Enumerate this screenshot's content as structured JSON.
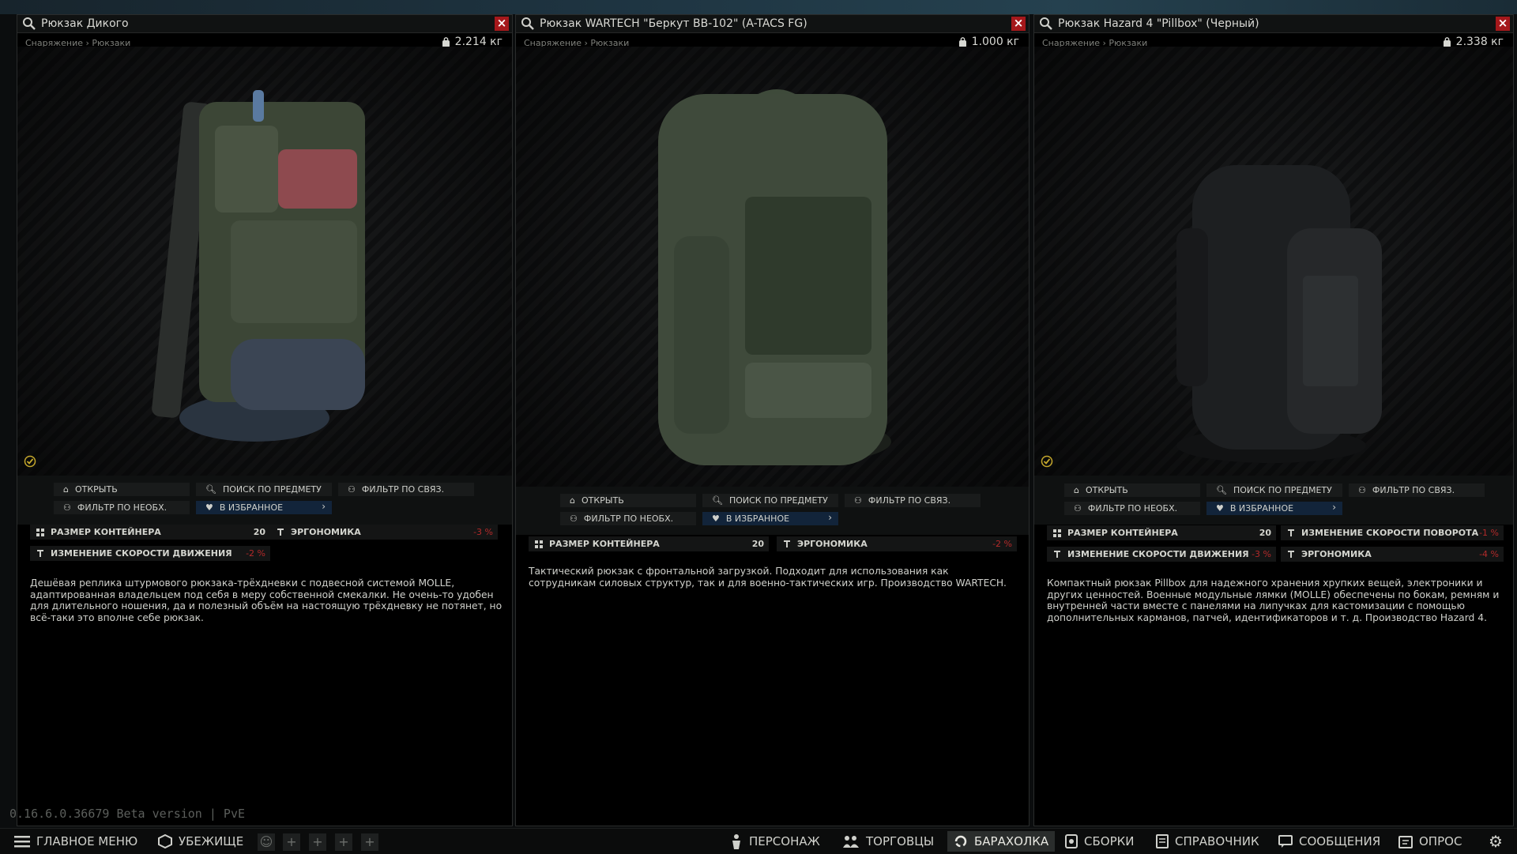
{
  "panels": [
    {
      "title": "Рюкзак Дикого",
      "breadcrumb": "Снаряжение › Рюкзаки",
      "weight": "2.214 кг",
      "actions": {
        "open": "ОТКРЫТЬ",
        "search": "ПОИСК ПО ПРЕДМЕТУ",
        "filter_linked": "ФИЛЬТР ПО СВЯЗ.",
        "filter_needed": "ФИЛЬТР ПО НЕОБХ.",
        "favorite": "В ИЗБРАННОЕ"
      },
      "stats": [
        {
          "label": "РАЗМЕР КОНТЕЙНЕРА",
          "value": "20"
        },
        {
          "label": "ЭРГОНОМИКА",
          "value": "-3 %"
        },
        {
          "label": "ИЗМЕНЕНИЕ СКОРОСТИ ДВИЖЕНИЯ",
          "value": "-2 %"
        }
      ],
      "description": "Дешёвая реплика штурмового рюкзака-трёхдневки с подвесной системой MOLLE, адаптированная владельцем под себя в меру собственной смекалки. Не очень-то удобен для длительного ношения, да и полезный объём на настоящую трёхдневку не потянет, но всё-таки это вполне себе рюкзак."
    },
    {
      "title": "Рюкзак WARTECH \"Беркут ВВ-102\" (A-TACS FG)",
      "breadcrumb": "Снаряжение › Рюкзаки",
      "weight": "1.000 кг",
      "actions": {
        "open": "ОТКРЫТЬ",
        "search": "ПОИСК ПО ПРЕДМЕТУ",
        "filter_linked": "ФИЛЬТР ПО СВЯЗ.",
        "filter_needed": "ФИЛЬТР ПО НЕОБХ.",
        "favorite": "В ИЗБРАННОЕ"
      },
      "stats": [
        {
          "label": "РАЗМЕР КОНТЕЙНЕРА",
          "value": "20"
        },
        {
          "label": "ЭРГОНОМИКА",
          "value": "-2 %"
        }
      ],
      "description": "Тактический рюкзак с фронтальной загрузкой. Подходит для использования как сотрудникам силовых структур, так и для военно-тактических игр. Производство WARTECH."
    },
    {
      "title": "Рюкзак Hazard 4 \"Pillbox\" (Черный)",
      "breadcrumb": "Снаряжение › Рюкзаки",
      "weight": "2.338 кг",
      "actions": {
        "open": "ОТКРЫТЬ",
        "search": "ПОИСК ПО ПРЕДМЕТУ",
        "filter_linked": "ФИЛЬТР ПО СВЯЗ.",
        "filter_needed": "ФИЛЬТР ПО НЕОБХ.",
        "favorite": "В ИЗБРАННОЕ"
      },
      "stats": [
        {
          "label": "РАЗМЕР КОНТЕЙНЕРА",
          "value": "20"
        },
        {
          "label": "ИЗМЕНЕНИЕ СКОРОСТИ ПОВОРОТА",
          "value": "-1 %"
        },
        {
          "label": "ИЗМЕНЕНИЕ СКОРОСТИ ДВИЖЕНИЯ",
          "value": "-3 %"
        },
        {
          "label": "ЭРГОНОМИКА",
          "value": "-4 %"
        }
      ],
      "description": "Компактный рюкзак Pillbox для надежного хранения хрупких вещей, электроники и других ценностей. Военные модульные лямки (MOLLE) обеспечены по бокам, ремням и внутренней части вместе с панелями на липучках для кастомизации с помощью дополнительных карманов, патчей, идентификаторов и т. д. Производство Hazard 4."
    }
  ],
  "version": "0.16.6.0.36679 Beta version | PvE",
  "bottom_bar": {
    "main_menu": "ГЛАВНОЕ МЕНЮ",
    "hideout": "УБЕЖИЩЕ",
    "character": "ПЕРСОНАЖ",
    "traders": "ТОРГОВЦЫ",
    "flea_market": "БАРАХОЛКА",
    "builds": "СБОРКИ",
    "handbook": "СПРАВОЧНИК",
    "messages": "СООБЩЕНИЯ",
    "survey": "ОПРОС"
  },
  "colors": {
    "close_red": "#a5181b",
    "negative_value": "#b42a2a",
    "favorite_bg": "#12243a"
  }
}
